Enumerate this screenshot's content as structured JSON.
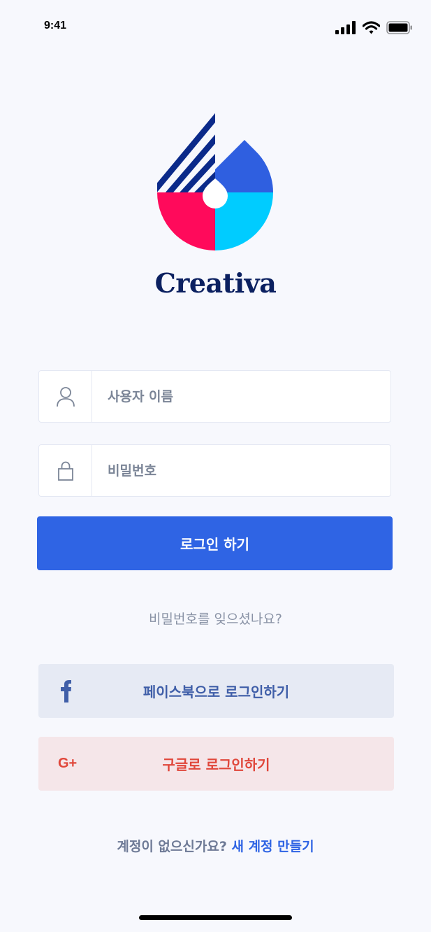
{
  "status_bar": {
    "time": "9:41"
  },
  "brand": {
    "name": "Creativa"
  },
  "login_form": {
    "username_placeholder": "사용자 이름",
    "password_placeholder": "비밀번호",
    "login_button_label": "로그인 하기",
    "forgot_password_label": "비밀번호를 잊으셨나요?"
  },
  "social_login": {
    "facebook_label": "페이스북으로 로그인하기",
    "facebook_icon": "facebook-icon",
    "google_label": "구글로 로그인하기",
    "google_icon": "google-plus-icon",
    "google_icon_text": "G+"
  },
  "signup": {
    "prompt": "계정이 없으신가요?",
    "link_label": "새 계정 만들기"
  },
  "colors": {
    "primary": "#2f64e4",
    "brand_dark": "#0b2060",
    "logo_red": "#ff0a5b",
    "logo_cyan": "#00ccff",
    "logo_blue": "#2f5fe0",
    "facebook": "#3f5ea8",
    "google": "#e0473b"
  }
}
